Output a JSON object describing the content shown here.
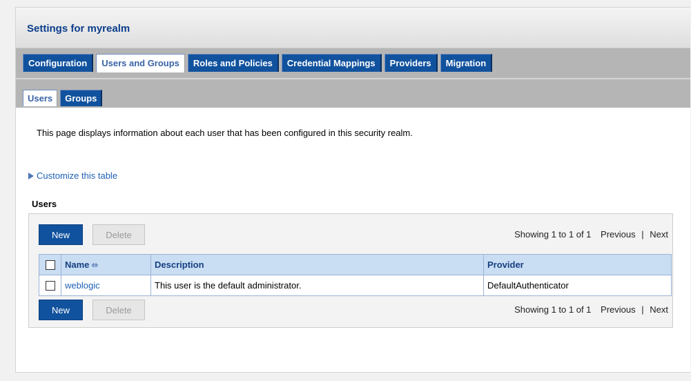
{
  "header": {
    "title": "Settings for myrealm"
  },
  "main_tabs": [
    {
      "label": "Configuration",
      "active": false
    },
    {
      "label": "Users and Groups",
      "active": true
    },
    {
      "label": "Roles and Policies",
      "active": false
    },
    {
      "label": "Credential Mappings",
      "active": false
    },
    {
      "label": "Providers",
      "active": false
    },
    {
      "label": "Migration",
      "active": false
    }
  ],
  "sub_tabs": [
    {
      "label": "Users",
      "active": true
    },
    {
      "label": "Groups",
      "active": false
    }
  ],
  "intro_text": "This page displays information about each user that has been configured in this security realm.",
  "customize_link": "Customize this table",
  "section_label": "Users",
  "toolbar": {
    "new_label": "New",
    "delete_label": "Delete",
    "showing_text": "Showing 1 to 1 of 1",
    "previous_label": "Previous",
    "separator": "|",
    "next_label": "Next"
  },
  "table": {
    "columns": [
      "Name",
      "Description",
      "Provider"
    ],
    "sort_icon": "sort-ascending-icon",
    "rows": [
      {
        "name": "weblogic",
        "description": "This user is the default administrator.",
        "provider": "DefaultAuthenticator"
      }
    ]
  },
  "colors": {
    "tab_blue": "#11529e",
    "link_blue": "#1f60b5",
    "header_bg": "#c9ddf3"
  }
}
